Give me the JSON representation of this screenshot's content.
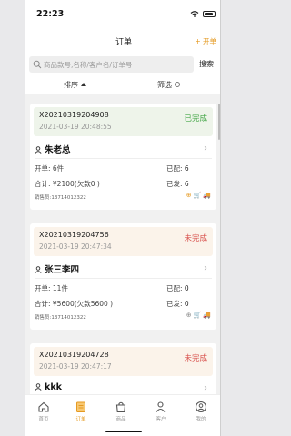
{
  "status_bar": {
    "time": "22:23"
  },
  "nav": {
    "title": "订单",
    "add_label": "+ 开单"
  },
  "search": {
    "placeholder": "商品款号,名称/客户名/订单号",
    "button": "搜索"
  },
  "filters": {
    "sort_label": "排序",
    "filter_label": "筛选"
  },
  "orders": [
    {
      "order_no": "X20210319204908",
      "datetime": "2021-03-19 20:48:55",
      "status": "已完成",
      "status_type": "done",
      "customer": "朱老总",
      "order_count": "开单: 6件",
      "total": "合计: ¥2100(欠款0 )",
      "assigned_label": "已配:",
      "assigned": "6",
      "sent_label": "已发:",
      "sent": "6",
      "salesman": "销售员:13714012322",
      "icon_style": "o"
    },
    {
      "order_no": "X20210319204756",
      "datetime": "2021-03-19 20:47:34",
      "status": "未完成",
      "status_type": "todo",
      "customer": "张三李四",
      "order_count": "开单: 11件",
      "total": "合计: ¥5600(欠款5600 )",
      "assigned_label": "已配:",
      "assigned": "0",
      "sent_label": "已发:",
      "sent": "0",
      "salesman": "销售员:13714012322",
      "icon_style": "g"
    },
    {
      "order_no": "X20210319204728",
      "datetime": "2021-03-19 20:47:17",
      "status": "未完成",
      "status_type": "todo",
      "customer": "kkk",
      "order_count": "",
      "total": "",
      "assigned_label": "",
      "assigned": "",
      "sent_label": "",
      "sent": "",
      "salesman": "",
      "icon_style": "g"
    }
  ],
  "tabs": [
    {
      "label": "首页",
      "icon": "home-icon",
      "active": false
    },
    {
      "label": "订单",
      "icon": "orders-icon",
      "active": true
    },
    {
      "label": "商品",
      "icon": "bag-icon",
      "active": false
    },
    {
      "label": "客户",
      "icon": "customers-icon",
      "active": false
    },
    {
      "label": "我的",
      "icon": "profile-icon",
      "active": false
    }
  ],
  "colors": {
    "accent": "#e59a22",
    "done": "#47a84a",
    "todo": "#d9534f"
  }
}
